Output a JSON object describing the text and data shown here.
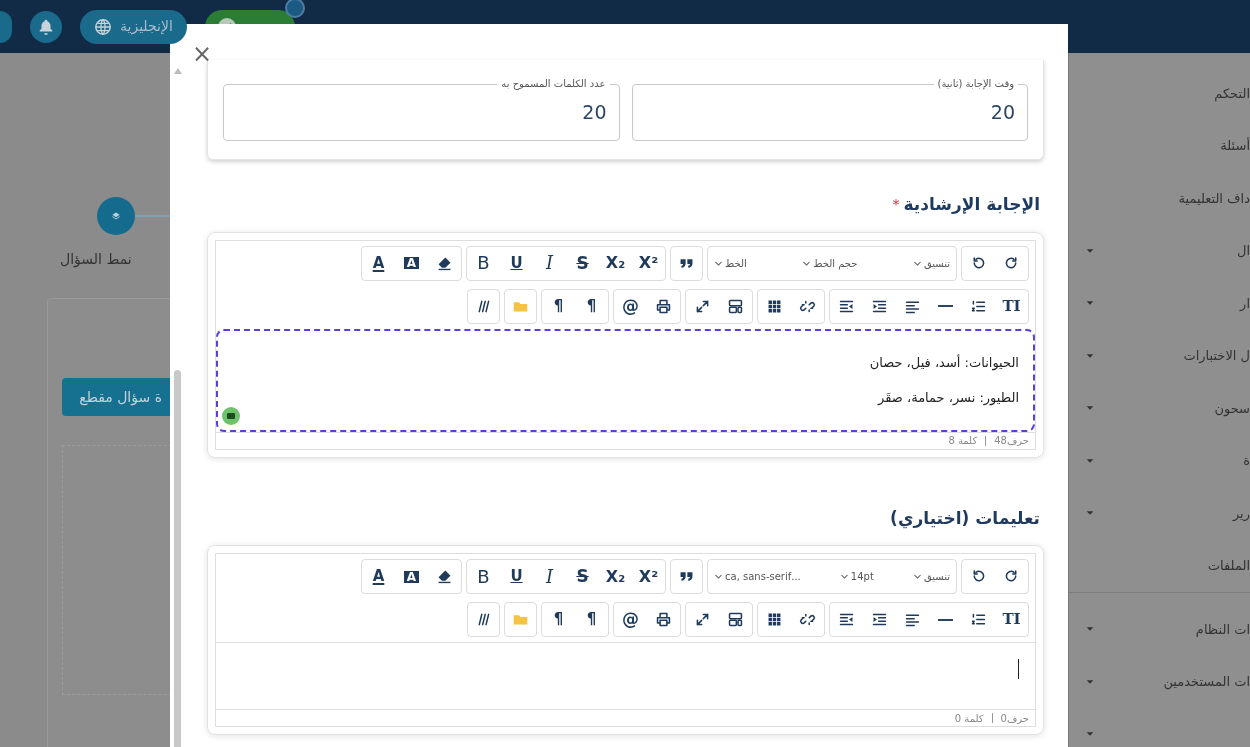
{
  "top_bar": {
    "items": [
      {
        "kind": "round"
      },
      {
        "kind": "bell"
      },
      {
        "kind": "language",
        "label": "الإنجليزية"
      },
      {
        "kind": "status",
        "dot": true
      }
    ]
  },
  "page": {
    "step_label": "نمط السؤال",
    "button": "ة سؤال مقطع"
  },
  "sidebar": {
    "groups": [
      [
        {
          "label": "التحكم",
          "expandable": false
        },
        {
          "label": "أسئلة",
          "expandable": false
        },
        {
          "label": "داف التعليمية",
          "expandable": false
        },
        {
          "label": "ال",
          "expandable": true
        },
        {
          "label": "ار",
          "expandable": true
        },
        {
          "label": "ل الاختبارات",
          "expandable": true
        },
        {
          "label": "سحون",
          "expandable": true
        },
        {
          "label": "ة",
          "expandable": true
        },
        {
          "label": "رير",
          "expandable": true
        },
        {
          "label": "الملفات",
          "expandable": false
        }
      ],
      [
        {
          "label": "ات النظام",
          "expandable": true
        },
        {
          "label": "ات المستخدمين",
          "expandable": true
        },
        {
          "expandable": true
        }
      ]
    ]
  },
  "modal": {
    "close": "×",
    "fields": [
      {
        "label": "وقت الإجابة (ثانية)",
        "value": "20"
      },
      {
        "label": "عدد الكلمات المسموح به",
        "value": "20"
      }
    ],
    "editors": [
      {
        "heading": "الإجابة الإرشادية",
        "required_mark": "*",
        "focused": true,
        "assistant": true,
        "caret": false,
        "toolbar": [
          [
            [
              {
                "kind": "redo"
              },
              {
                "kind": "undo"
              }
            ],
            [
              {
                "kind": "select",
                "label": "تنسيق"
              },
              {
                "kind": "select",
                "label": "حجم الخط"
              },
              {
                "kind": "select",
                "label": "الخط"
              }
            ],
            [
              {
                "kind": "quote"
              }
            ],
            [
              {
                "kind": "superscript",
                "glyph": "X²"
              },
              {
                "kind": "subscript",
                "glyph": "X₂"
              },
              {
                "kind": "strike",
                "glyph": "S"
              },
              {
                "kind": "italic",
                "glyph": "I"
              },
              {
                "kind": "underline",
                "glyph": "U"
              },
              {
                "kind": "bold",
                "glyph": "B"
              }
            ],
            [
              {
                "kind": "eraser"
              },
              {
                "kind": "bg-color",
                "glyph": "A"
              },
              {
                "kind": "text-color",
                "glyph": "A"
              }
            ]
          ],
          [
            [
              {
                "kind": "text-direction",
                "glyph": "TI"
              },
              {
                "kind": "numbered-list"
              },
              {
                "kind": "rule"
              },
              {
                "kind": "align"
              },
              {
                "kind": "indent"
              },
              {
                "kind": "outdent"
              }
            ],
            [
              {
                "kind": "link"
              },
              {
                "kind": "table"
              }
            ],
            [
              {
                "kind": "layout"
              },
              {
                "kind": "fullscreen"
              }
            ],
            [
              {
                "kind": "print"
              },
              {
                "kind": "mention",
                "glyph": "@"
              }
            ],
            [
              {
                "kind": "paragraph",
                "glyph": "¶"
              },
              {
                "kind": "paragraph",
                "glyph": "¶"
              }
            ],
            [
              {
                "kind": "folder"
              }
            ],
            [
              {
                "kind": "special"
              }
            ]
          ]
        ],
        "lines": [
          "الحيوانات: أسد، فيل، حصان",
          "الطيور: نسر، حمامة، صقَر"
        ],
        "chars": "حرف48",
        "words": "كلمة 8"
      },
      {
        "heading": "تعليمات (اختياري)",
        "focused": false,
        "assistant": false,
        "caret": true,
        "toolbar": [
          [
            [
              {
                "kind": "redo"
              },
              {
                "kind": "undo"
              }
            ],
            [
              {
                "kind": "select",
                "label": "تنسيق"
              },
              {
                "kind": "select",
                "label": "14pt"
              },
              {
                "kind": "select",
                "label": "...ca, sans-serif"
              }
            ],
            [
              {
                "kind": "quote"
              }
            ],
            [
              {
                "kind": "superscript",
                "glyph": "X²"
              },
              {
                "kind": "subscript",
                "glyph": "X₂"
              },
              {
                "kind": "strike",
                "glyph": "S"
              },
              {
                "kind": "italic",
                "glyph": "I"
              },
              {
                "kind": "underline",
                "glyph": "U"
              },
              {
                "kind": "bold",
                "glyph": "B"
              }
            ],
            [
              {
                "kind": "eraser"
              },
              {
                "kind": "bg-color",
                "glyph": "A"
              },
              {
                "kind": "text-color",
                "glyph": "A"
              }
            ]
          ],
          [
            [
              {
                "kind": "text-direction",
                "glyph": "TI"
              },
              {
                "kind": "numbered-list"
              },
              {
                "kind": "rule"
              },
              {
                "kind": "align"
              },
              {
                "kind": "indent"
              },
              {
                "kind": "outdent"
              }
            ],
            [
              {
                "kind": "link"
              },
              {
                "kind": "table"
              }
            ],
            [
              {
                "kind": "layout"
              },
              {
                "kind": "fullscreen"
              }
            ],
            [
              {
                "kind": "print"
              },
              {
                "kind": "mention",
                "glyph": "@"
              }
            ],
            [
              {
                "kind": "paragraph",
                "glyph": "¶"
              },
              {
                "kind": "paragraph",
                "glyph": "¶"
              }
            ],
            [
              {
                "kind": "folder"
              }
            ],
            [
              {
                "kind": "special"
              }
            ]
          ]
        ],
        "chars": "حرف0",
        "words": "كلمة 0"
      }
    ]
  }
}
